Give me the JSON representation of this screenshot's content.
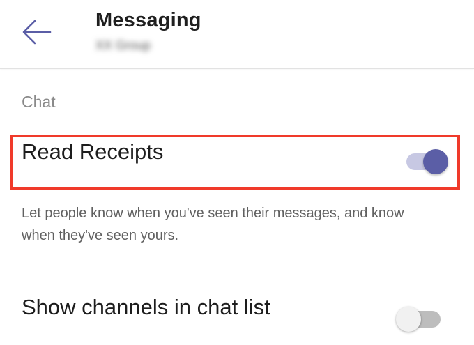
{
  "header": {
    "title": "Messaging",
    "subtitle": "XX Group",
    "back_icon": "arrow-left-icon"
  },
  "colors": {
    "accent": "#5b5ea6",
    "accent_track": "#c7c8e3",
    "highlight": "#f03a2a"
  },
  "section": {
    "title": "Chat"
  },
  "settings": [
    {
      "label": "Read Receipts",
      "description": "Let people know when you've seen their messages, and know when they've seen yours.",
      "enabled": true
    },
    {
      "label": "Show channels in chat list",
      "enabled": false
    }
  ]
}
